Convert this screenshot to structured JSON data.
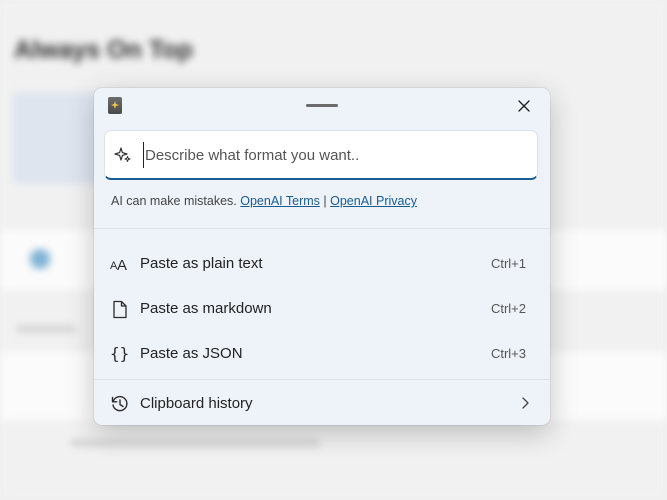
{
  "background": {
    "app_title": "Always On Top"
  },
  "panel": {
    "prompt": {
      "placeholder": "Describe what format you want.."
    },
    "disclaimer": {
      "text": "AI can make mistakes.",
      "terms_link": "OpenAI Terms",
      "separator": "|",
      "privacy_link": "OpenAI Privacy"
    },
    "menu": [
      {
        "label": "Paste as plain text",
        "shortcut": "Ctrl+1",
        "icon": "font-size-icon"
      },
      {
        "label": "Paste as markdown",
        "shortcut": "Ctrl+2",
        "icon": "document-icon"
      },
      {
        "label": "Paste as JSON",
        "shortcut": "Ctrl+3",
        "icon": "braces-icon"
      }
    ],
    "history": {
      "label": "Clipboard history",
      "icon": "history-icon"
    }
  },
  "colors": {
    "accent": "#1a5b8f",
    "panel_bg": "#eef3fa"
  }
}
